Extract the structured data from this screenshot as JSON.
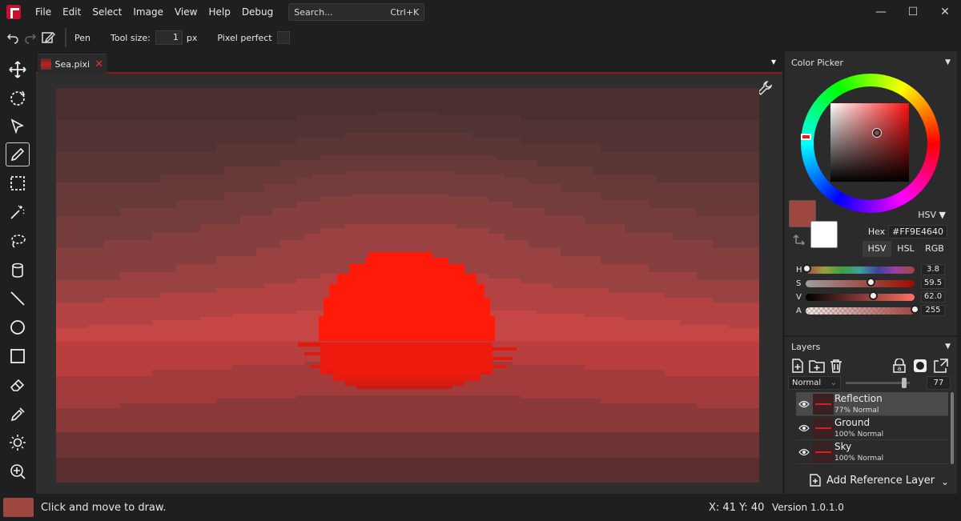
{
  "menu": [
    "File",
    "Edit",
    "Select",
    "Image",
    "View",
    "Help",
    "Debug"
  ],
  "search": {
    "placeholder": "Search...",
    "shortcut": "Ctrl+K"
  },
  "window": {
    "minimize": "—",
    "maximize": "☐",
    "close": "✕"
  },
  "toolopts": {
    "tool_name": "Pen",
    "size_label": "Tool size:",
    "size_value": "1",
    "size_unit": "px",
    "pixel_perfect_label": "Pixel perfect"
  },
  "tools": [
    "move-icon",
    "lasso-rotate-icon",
    "select-pointer-icon",
    "pen-icon",
    "rectangle-select-icon",
    "magic-wand-icon",
    "lasso-icon",
    "bucket-icon",
    "line-icon",
    "ellipse-icon",
    "rectangle-icon",
    "eraser-icon",
    "color-picker-icon",
    "brightness-icon",
    "zoom-icon"
  ],
  "document": {
    "tab_label": "Sea.pixi",
    "close_glyph": "✕",
    "menu_glyph": "▾"
  },
  "color_picker": {
    "title": "Color Picker",
    "mode_dropdown": "HSV",
    "hex_label": "Hex",
    "hex_value": "#FF9E4640",
    "modes": [
      "HSV",
      "HSL",
      "RGB"
    ],
    "active_mode": "HSV",
    "primary_color": "#9e4640",
    "secondary_color": "#ffffff",
    "sliders": [
      {
        "label": "H",
        "value": "3.8",
        "fraction": 0.01
      },
      {
        "label": "S",
        "value": "59.5",
        "fraction": 0.595
      },
      {
        "label": "V",
        "value": "62.0",
        "fraction": 0.62
      },
      {
        "label": "A",
        "value": "255",
        "fraction": 1.0
      }
    ]
  },
  "layers": {
    "title": "Layers",
    "blend_mode": "Normal",
    "opacity": "77",
    "items": [
      {
        "name": "Reflection",
        "meta": "77%  Normal",
        "selected": true
      },
      {
        "name": "Ground",
        "meta": "100%  Normal",
        "selected": false
      },
      {
        "name": "Sky",
        "meta": "100%  Normal",
        "selected": false
      }
    ],
    "add_reference": "Add Reference Layer"
  },
  "status": {
    "hint": "Click and move to draw.",
    "coords": "X: 41 Y: 40",
    "version": "Version 1.0.1.0",
    "color": "#9e4640"
  }
}
